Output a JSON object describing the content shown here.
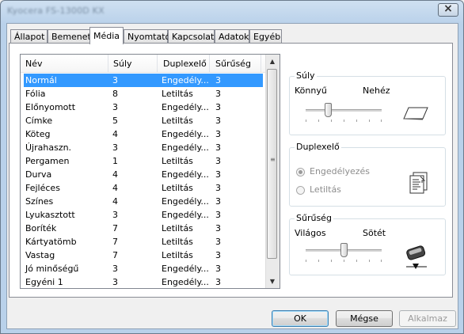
{
  "window": {
    "title": "Kyocera FS-1300D KX"
  },
  "tabs": [
    {
      "label": "Állapot",
      "active": false
    },
    {
      "label": "Bemenet",
      "active": false
    },
    {
      "label": "Média",
      "active": true
    },
    {
      "label": "Nyomtató",
      "active": false
    },
    {
      "label": "Kapcsolat",
      "active": false
    },
    {
      "label": "Adatok",
      "active": false
    },
    {
      "label": "Egyéb",
      "active": false
    }
  ],
  "media_list": {
    "columns": [
      "Név",
      "Súly",
      "Duplexelő",
      "Sűrűség"
    ],
    "rows": [
      [
        "Normál",
        "3",
        "Engedély...",
        "3"
      ],
      [
        "Fólia",
        "8",
        "Letiltás",
        "3"
      ],
      [
        "Előnyomott",
        "3",
        "Engedély...",
        "3"
      ],
      [
        "Címke",
        "5",
        "Letiltás",
        "3"
      ],
      [
        "Köteg",
        "4",
        "Engedély...",
        "3"
      ],
      [
        "Újrahaszn.",
        "3",
        "Engedély...",
        "3"
      ],
      [
        "Pergamen",
        "1",
        "Letiltás",
        "3"
      ],
      [
        "Durva",
        "4",
        "Engedély...",
        "3"
      ],
      [
        "Fejléces",
        "4",
        "Letiltás",
        "3"
      ],
      [
        "Színes",
        "4",
        "Engedély...",
        "3"
      ],
      [
        "Lyukasztott",
        "3",
        "Engedély...",
        "3"
      ],
      [
        "Boríték",
        "7",
        "Letiltás",
        "3"
      ],
      [
        "Kártyatömb",
        "7",
        "Letiltás",
        "3"
      ],
      [
        "Vastag",
        "7",
        "Letiltás",
        "3"
      ],
      [
        "Jó minőségű",
        "3",
        "Engedély...",
        "3"
      ],
      [
        "Egyéni 1",
        "3",
        "Engedély...",
        "3"
      ]
    ],
    "selected_row": 0
  },
  "weight_group": {
    "label": "Súly",
    "min_label": "Könnyű",
    "max_label": "Nehéz",
    "value_fraction": 0.29
  },
  "duplex_group": {
    "label": "Duplexelő",
    "options": [
      {
        "label": "Engedélyezés",
        "checked": true
      },
      {
        "label": "Letiltás",
        "checked": false
      }
    ]
  },
  "density_group": {
    "label": "Sűrűség",
    "min_label": "Világos",
    "max_label": "Sötét",
    "value_fraction": 0.5
  },
  "buttons": {
    "ok": "OK",
    "cancel": "Mégse",
    "apply": "Alkalmaz"
  },
  "icons": {
    "close": "close-icon",
    "paper": "paper-sheet-icon",
    "duplex": "duplex-page-icon",
    "toner": "toner-cartridge-icon"
  }
}
